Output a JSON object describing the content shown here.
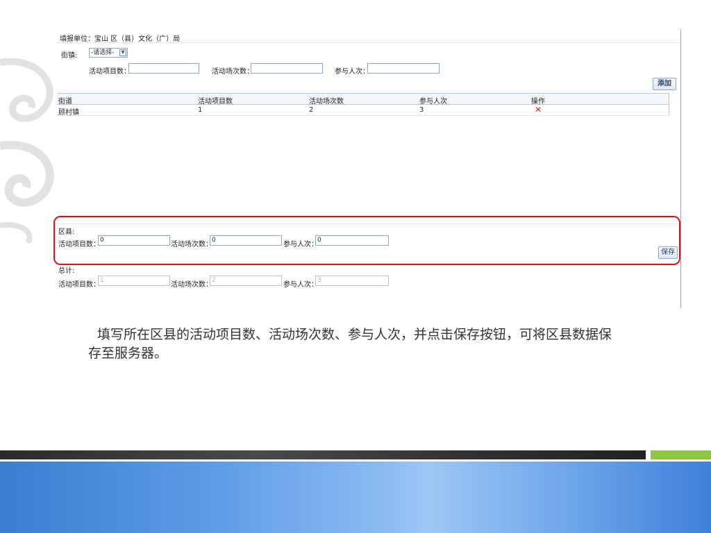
{
  "form": {
    "unit_label": "填报单位：宝山 区（县）文化（广）局",
    "street_label": "街镇:",
    "street_select": "-请选择-",
    "item_count_label": "活动项目数：",
    "session_count_label": "活动场次数：",
    "attendance_label": "参与人次：",
    "add_button": "添加"
  },
  "table": {
    "headers": [
      "街道",
      "活动项目数",
      "活动场次数",
      "参与人次",
      "操作"
    ],
    "rows": [
      {
        "street": "顾村镇",
        "items": "1",
        "sessions": "2",
        "attendance": "3",
        "action_icon": "✕"
      }
    ]
  },
  "district": {
    "title": "区县:",
    "item_count_label": "活动项目数：",
    "item_count": "0",
    "session_count_label": "活动场次数：",
    "session_count": "0",
    "attendance_label": "参与人次：",
    "attendance": "0",
    "save_button": "保存"
  },
  "total": {
    "title": "总计:",
    "item_count_label": "活动项目数：",
    "item_count": "1",
    "session_count_label": "活动场次数：",
    "session_count": "2",
    "attendance_label": "参与人次：",
    "attendance": "3"
  },
  "caption": "填写所在区县的活动项目数、活动场次数、参与人次，并点击保存按钮，可将区县数据保存至服务器。",
  "colors": {
    "highlight": "#d8131a",
    "accent_green": "#8dc63f",
    "delete_red": "#e02020"
  }
}
